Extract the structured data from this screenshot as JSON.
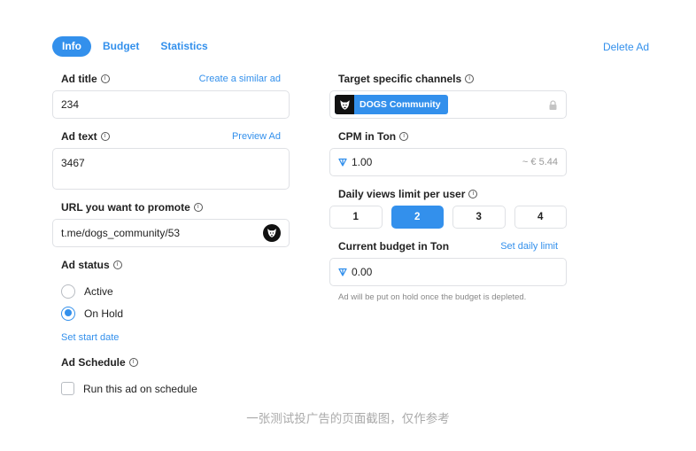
{
  "tabs": [
    {
      "label": "Info",
      "active": true
    },
    {
      "label": "Budget",
      "active": false
    },
    {
      "label": "Statistics",
      "active": false
    }
  ],
  "header": {
    "delete_label": "Delete Ad"
  },
  "left": {
    "ad_title": {
      "label": "Ad title",
      "action": "Create a similar ad",
      "value": "234"
    },
    "ad_text": {
      "label": "Ad text",
      "action": "Preview Ad",
      "value": "3467"
    },
    "url": {
      "label": "URL you want to promote",
      "value": "t.me/dogs_community/53",
      "icon": "dog-icon"
    },
    "ad_status": {
      "label": "Ad status",
      "options": [
        {
          "label": "Active",
          "checked": false
        },
        {
          "label": "On Hold",
          "checked": true
        }
      ],
      "start_date_link": "Set start date"
    },
    "ad_schedule": {
      "label": "Ad Schedule",
      "checkbox_label": "Run this ad on schedule",
      "checked": false
    }
  },
  "right": {
    "channels": {
      "label": "Target specific channels",
      "chip_label": "DOGS Community",
      "locked": true
    },
    "cpm": {
      "label": "CPM in Ton",
      "value": "1.00",
      "approx": "~ € 5.44",
      "currency_icon": "ton-icon"
    },
    "daily_views": {
      "label": "Daily views limit per user",
      "options": [
        "1",
        "2",
        "3",
        "4"
      ],
      "selected": "2"
    },
    "budget": {
      "label": "Current budget in Ton",
      "action": "Set daily limit",
      "value": "0.00",
      "hint": "Ad will be put on hold once the budget is depleted."
    }
  },
  "caption": "一张测试投广告的页面截图，仅作参考",
  "colors": {
    "accent": "#3390ec",
    "border": "#dfe1e5",
    "muted": "#888888"
  }
}
